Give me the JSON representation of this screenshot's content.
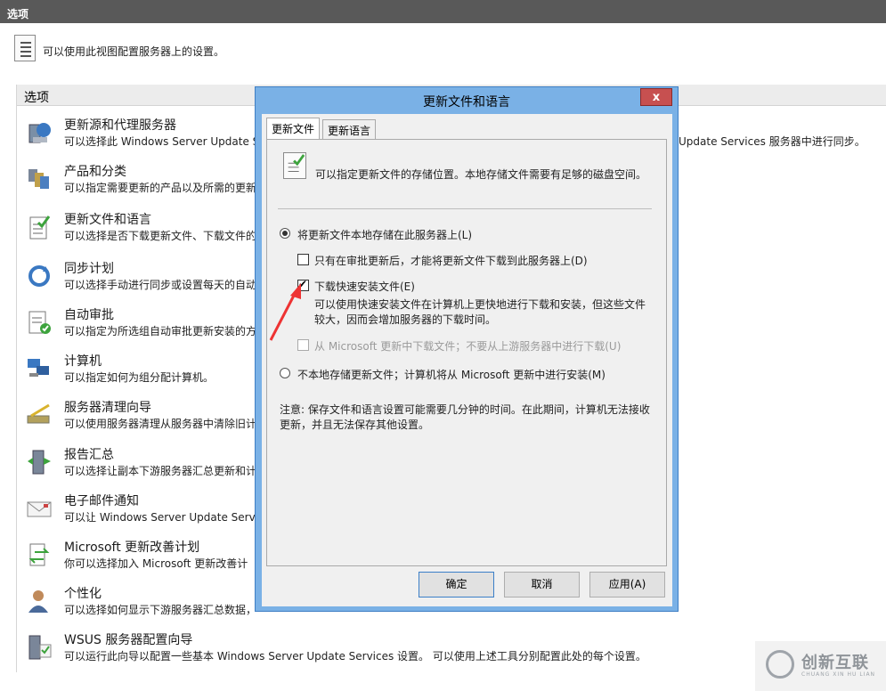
{
  "window": {
    "title": "选项"
  },
  "description": {
    "text": "可以使用此视图配置服务器上的设置。"
  },
  "options": {
    "header": "选项",
    "items": [
      {
        "title": "更新源和代理服务器",
        "sub": "可以选择此 Windows Server Update S",
        "sub_right": "Update Services 服务器中进行同步。",
        "icon": "update-source-icon"
      },
      {
        "title": "产品和分类",
        "sub": "可以指定需要更新的产品以及所需的更新",
        "icon": "products-icon"
      },
      {
        "title": "更新文件和语言",
        "sub": "可以选择是否下载更新文件、下载文件的",
        "icon": "update-files-icon"
      },
      {
        "title": "同步计划",
        "sub": "可以选择手动进行同步或设置每天的自动",
        "icon": "sync-icon"
      },
      {
        "title": "自动审批",
        "sub": "可以指定为所选组自动审批更新安装的方",
        "icon": "auto-approve-icon"
      },
      {
        "title": "计算机",
        "sub": "可以指定如何为组分配计算机。",
        "icon": "computers-icon"
      },
      {
        "title": "服务器清理向导",
        "sub": "可以使用服务器清理从服务器中清除旧计",
        "icon": "cleanup-icon"
      },
      {
        "title": "报告汇总",
        "sub": "可以选择让副本下游服务器汇总更新和计",
        "icon": "report-icon"
      },
      {
        "title": "电子邮件通知",
        "sub": "可以让 Windows Server Update Servic",
        "icon": "email-icon"
      },
      {
        "title": "Microsoft 更新改善计划",
        "sub": "你可以选择加入 Microsoft 更新改善计",
        "icon": "improvement-icon"
      },
      {
        "title": "个性化",
        "sub": "可以选择如何显示下游服务器汇总数据，",
        "icon": "personalize-icon"
      },
      {
        "title": "WSUS 服务器配置向导",
        "sub": "可以运行此向导以配置一些基本 Windows Server Update Services 设置。 可以使用上述工具分别配置此处的每个设置。",
        "icon": "wizard-icon"
      }
    ]
  },
  "dialog": {
    "title": "更新文件和语言",
    "close": "x",
    "tabs": [
      "更新文件",
      "更新语言"
    ],
    "panel_desc": "可以指定更新文件的存储位置。本地存储文件需要有足够的磁盘空间。",
    "radio_local": "将更新文件本地存储在此服务器上(L)",
    "check_approved": "只有在审批更新后，才能将更新文件下载到此服务器上(D)",
    "check_express": "下载快速安装文件(E)",
    "express_desc": "可以使用快速安装文件在计算机上更快地进行下载和安装，但这些文件较大，因而会增加服务器的下载时间。",
    "check_microsoft": "从 Microsoft 更新中下载文件；不要从上游服务器中进行下载(U)",
    "radio_nolocal": "不本地存储更新文件；计算机将从 Microsoft 更新中进行安装(M)",
    "note": "注意: 保存文件和语言设置可能需要几分钟的时间。在此期间，计算机无法接收更新，并且无法保存其他设置。",
    "buttons": {
      "ok": "确定",
      "cancel": "取消",
      "apply": "应用(A)"
    }
  },
  "watermark": {
    "text": "创新互联",
    "sub": "CHUANG XIN HU LIAN"
  }
}
